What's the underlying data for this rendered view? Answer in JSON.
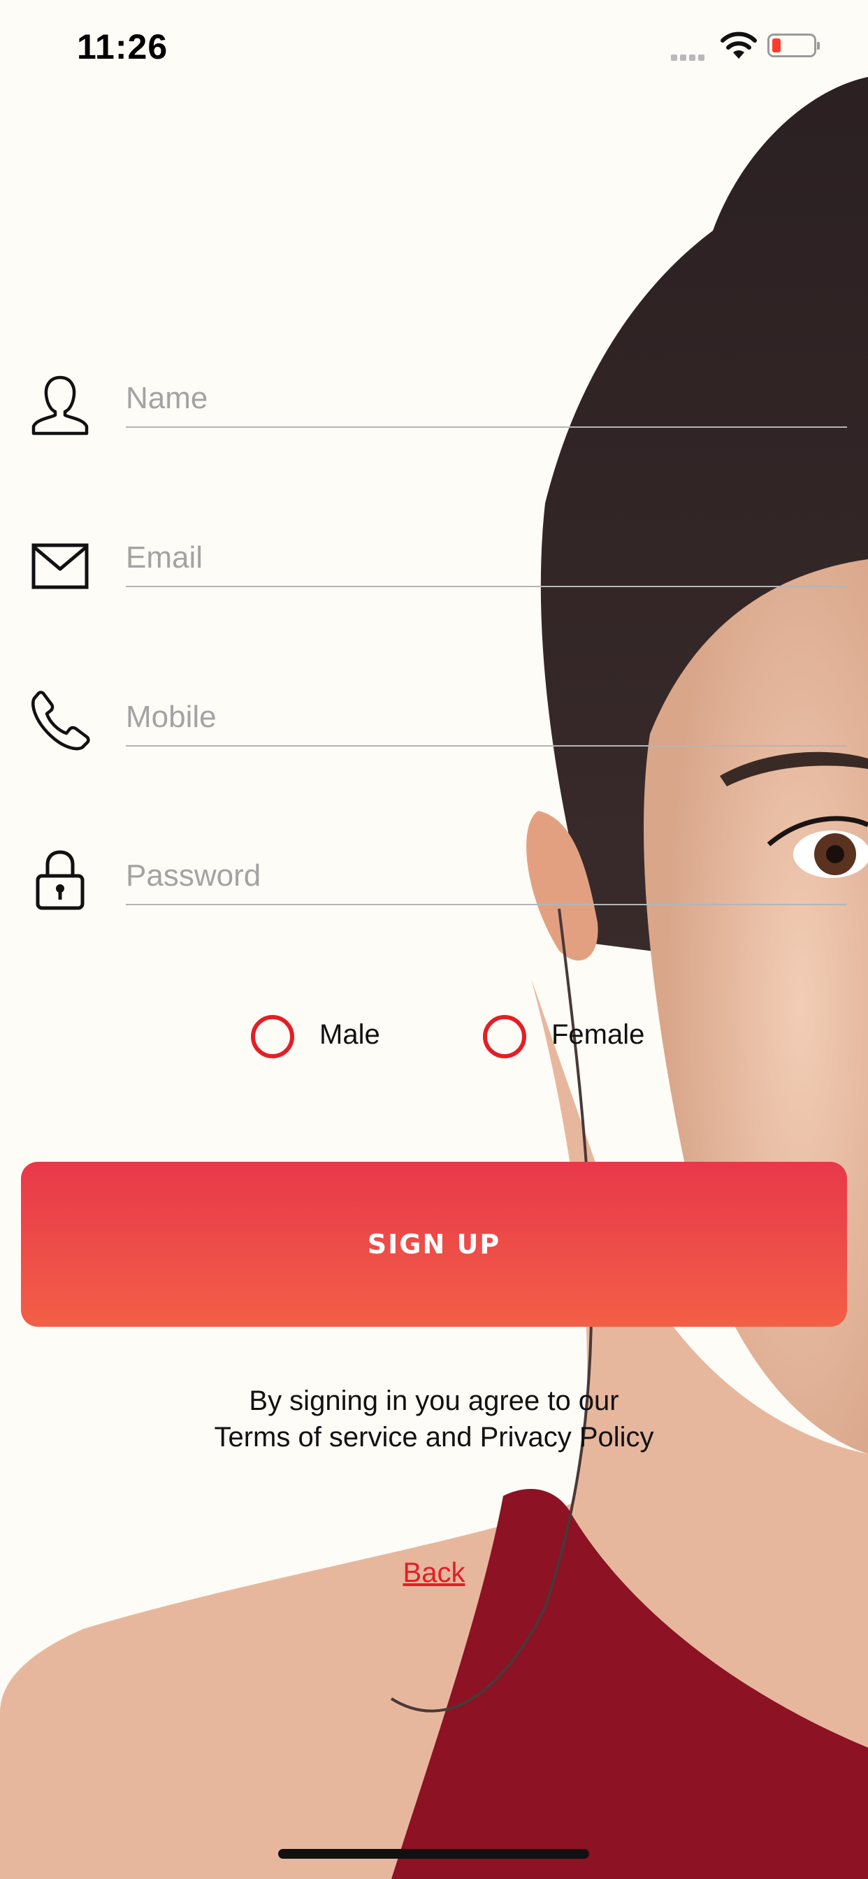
{
  "status_bar": {
    "time": "11:26"
  },
  "form": {
    "fields": [
      {
        "placeholder": "Name",
        "icon": "person-icon"
      },
      {
        "placeholder": "Email",
        "icon": "envelope-icon"
      },
      {
        "placeholder": "Mobile",
        "icon": "phone-icon"
      },
      {
        "placeholder": "Password",
        "icon": "lock-icon"
      }
    ],
    "gender_options": [
      "Male",
      "Female"
    ]
  },
  "signup_button_label": "SIGN UP",
  "terms": {
    "line1": "By signing in you agree to our",
    "line2": "Terms of service and Privacy Policy"
  },
  "back_label": "Back",
  "colors": {
    "accent": "#e41e26",
    "button_top": "#e8384a",
    "button_bottom": "#f35f46",
    "background": "#fdfcf7"
  }
}
